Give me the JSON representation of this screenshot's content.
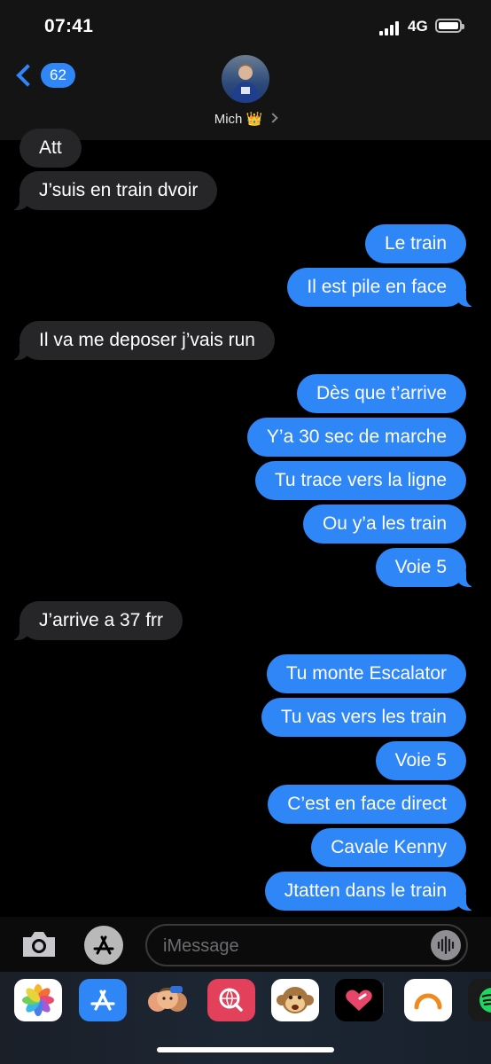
{
  "status_bar": {
    "time": "07:41",
    "network": "4G"
  },
  "header": {
    "back_count": "62",
    "contact_name": "Mich 👑"
  },
  "messages": [
    {
      "from": "them",
      "text": "Att"
    },
    {
      "from": "them",
      "text": "J’suis en train dvoir"
    },
    {
      "from": "me",
      "text": "Le train"
    },
    {
      "from": "me",
      "text": "Il est pile en face"
    },
    {
      "from": "them",
      "text": "Il va me deposer j’vais run"
    },
    {
      "from": "me",
      "text": "Dès que t’arrive"
    },
    {
      "from": "me",
      "text": "Y’a 30 sec de marche"
    },
    {
      "from": "me",
      "text": "Tu trace vers la ligne"
    },
    {
      "from": "me",
      "text": "Ou y’a les train"
    },
    {
      "from": "me",
      "text": "Voie 5"
    },
    {
      "from": "them",
      "text": "J’arrive a 37 frr"
    },
    {
      "from": "me",
      "text": "Tu monte Escalator"
    },
    {
      "from": "me",
      "text": "Tu vas vers les train"
    },
    {
      "from": "me",
      "text": "Voie 5"
    },
    {
      "from": "me",
      "text": "C’est en face direct"
    },
    {
      "from": "me",
      "text": "Cavale Kenny"
    },
    {
      "from": "me",
      "text": "Jtatten dans le train"
    }
  ],
  "input": {
    "placeholder": "iMessage"
  },
  "app_drawer": [
    "photos-icon",
    "app-store-icon",
    "memoji-icon",
    "images-search-icon",
    "animoji-icon",
    "digital-touch-icon",
    "arc-app-icon",
    "spotify-icon"
  ],
  "colors": {
    "outgoing": "#2f86f6",
    "incoming": "#262628",
    "background": "#000000"
  }
}
